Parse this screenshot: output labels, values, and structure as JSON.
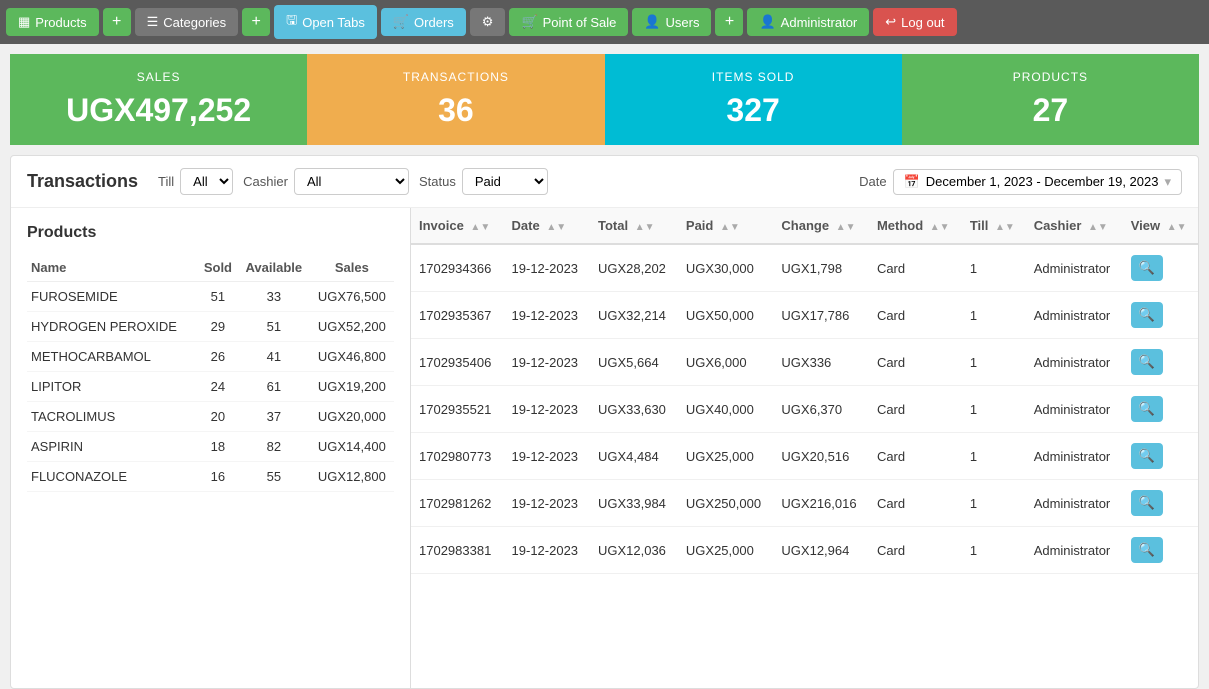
{
  "navbar": {
    "products_label": "Products",
    "categories_label": "Categories",
    "open_tabs_label": "Open Tabs",
    "orders_label": "Orders",
    "point_of_sale_label": "Point of Sale",
    "users_label": "Users",
    "administrator_label": "Administrator",
    "logout_label": "Log out"
  },
  "stats": {
    "sales_label": "SALES",
    "sales_value": "UGX497,252",
    "transactions_label": "TRANSACTIONS",
    "transactions_value": "36",
    "items_sold_label": "ITEMS SOLD",
    "items_sold_value": "327",
    "products_label": "PRODUCTS",
    "products_value": "27"
  },
  "filters": {
    "transactions_title": "Transactions",
    "till_label": "Till",
    "till_value": "All",
    "cashier_label": "Cashier",
    "cashier_value": "All",
    "status_label": "Status",
    "status_value": "Paid",
    "date_label": "Date",
    "date_range": "December 1, 2023 - December 19, 2023"
  },
  "products": {
    "title": "Products",
    "columns": {
      "name": "Name",
      "sold": "Sold",
      "available": "Available",
      "sales": "Sales"
    },
    "rows": [
      {
        "name": "FUROSEMIDE",
        "sold": "51",
        "available": "33",
        "sales": "UGX76,500"
      },
      {
        "name": "HYDROGEN PEROXIDE",
        "sold": "29",
        "available": "51",
        "sales": "UGX52,200"
      },
      {
        "name": "METHOCARBAMOL",
        "sold": "26",
        "available": "41",
        "sales": "UGX46,800"
      },
      {
        "name": "LIPITOR",
        "sold": "24",
        "available": "61",
        "sales": "UGX19,200"
      },
      {
        "name": "TACROLIMUS",
        "sold": "20",
        "available": "37",
        "sales": "UGX20,000"
      },
      {
        "name": "ASPIRIN",
        "sold": "18",
        "available": "82",
        "sales": "UGX14,400"
      },
      {
        "name": "FLUCONAZOLE",
        "sold": "16",
        "available": "55",
        "sales": "UGX12,800"
      }
    ]
  },
  "transactions": {
    "columns": {
      "invoice": "Invoice",
      "date": "Date",
      "total": "Total",
      "paid": "Paid",
      "change": "Change",
      "method": "Method",
      "till": "Till",
      "cashier": "Cashier",
      "view": "View"
    },
    "rows": [
      {
        "invoice": "1702934366",
        "date": "19-12-2023",
        "total": "UGX28,202",
        "paid": "UGX30,000",
        "change": "UGX1,798",
        "method": "Card",
        "till": "1",
        "cashier": "Administrator"
      },
      {
        "invoice": "1702935367",
        "date": "19-12-2023",
        "total": "UGX32,214",
        "paid": "UGX50,000",
        "change": "UGX17,786",
        "method": "Card",
        "till": "1",
        "cashier": "Administrator"
      },
      {
        "invoice": "1702935406",
        "date": "19-12-2023",
        "total": "UGX5,664",
        "paid": "UGX6,000",
        "change": "UGX336",
        "method": "Card",
        "till": "1",
        "cashier": "Administrator"
      },
      {
        "invoice": "1702935521",
        "date": "19-12-2023",
        "total": "UGX33,630",
        "paid": "UGX40,000",
        "change": "UGX6,370",
        "method": "Card",
        "till": "1",
        "cashier": "Administrator"
      },
      {
        "invoice": "1702980773",
        "date": "19-12-2023",
        "total": "UGX4,484",
        "paid": "UGX25,000",
        "change": "UGX20,516",
        "method": "Card",
        "till": "1",
        "cashier": "Administrator"
      },
      {
        "invoice": "1702981262",
        "date": "19-12-2023",
        "total": "UGX33,984",
        "paid": "UGX250,000",
        "change": "UGX216,016",
        "method": "Card",
        "till": "1",
        "cashier": "Administrator"
      },
      {
        "invoice": "1702983381",
        "date": "19-12-2023",
        "total": "UGX12,036",
        "paid": "UGX25,000",
        "change": "UGX12,964",
        "method": "Card",
        "till": "1",
        "cashier": "Administrator"
      }
    ],
    "view_button_label": "🔍"
  }
}
